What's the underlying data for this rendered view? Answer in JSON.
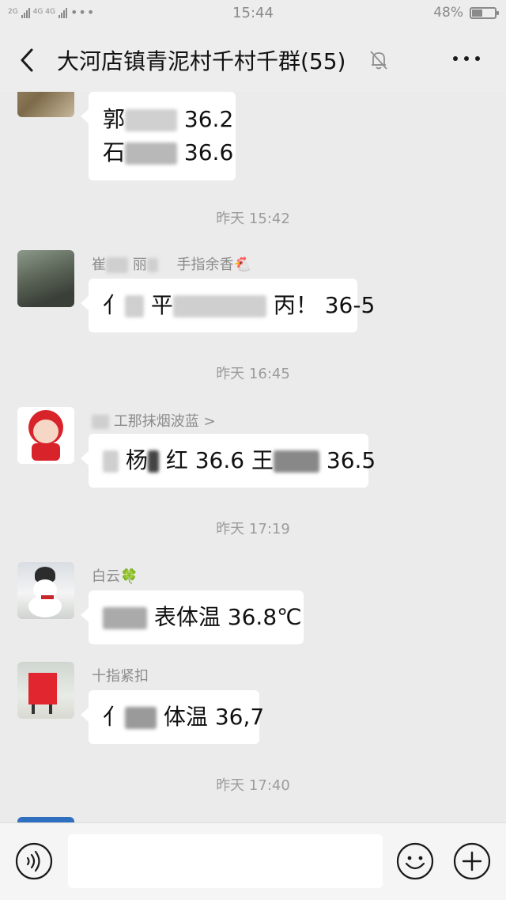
{
  "status_bar": {
    "network_left": "2G",
    "network_right": "4G 4G",
    "dots": "•••",
    "time": "15:44",
    "battery_pct": "48%",
    "battery_level": 0.48
  },
  "header": {
    "title": "大河店镇青泥村千村千群(55)",
    "back_icon": "chevron-left-icon",
    "mute_icon": "bell-mute-icon",
    "more_icon": "more-dots-icon"
  },
  "messages": [
    {
      "type": "partial",
      "lines": [
        {
          "pre": "郭",
          "post": "36.2"
        },
        {
          "pre": "石",
          "post": "36.6"
        }
      ]
    },
    {
      "type": "timestamp",
      "text": "昨天 15:42"
    },
    {
      "type": "msg",
      "sender_pre": "崔",
      "sender_mid": "丽",
      "sender_post": "手指余香🐔",
      "text_pre": "亻",
      "text_mid": "平",
      "text_post": "丙！ 36-5"
    },
    {
      "type": "timestamp",
      "text": "昨天 16:45"
    },
    {
      "type": "msg",
      "sender": "工那抹烟波蓝 >",
      "text_a": "杨",
      "text_b": "红 36.6",
      "text_c": "王",
      "text_d": "36.5"
    },
    {
      "type": "timestamp",
      "text": "昨天 17:19"
    },
    {
      "type": "msg",
      "sender": "白云🍀",
      "text_pre": "",
      "text_post": "表体温 36.8℃"
    },
    {
      "type": "msg",
      "sender": "十指紧扣",
      "text_pre": "亻",
      "text_post": "体温 36,7"
    },
    {
      "type": "timestamp",
      "text": "昨天 17:40"
    }
  ],
  "input": {
    "voice_icon": "voice-icon",
    "emoji_icon": "emoji-icon",
    "plus_icon": "plus-icon",
    "value": ""
  },
  "colors": {
    "background": "#ebebeb",
    "bubble": "#ffffff",
    "timestamp": "#9c9c9c"
  }
}
